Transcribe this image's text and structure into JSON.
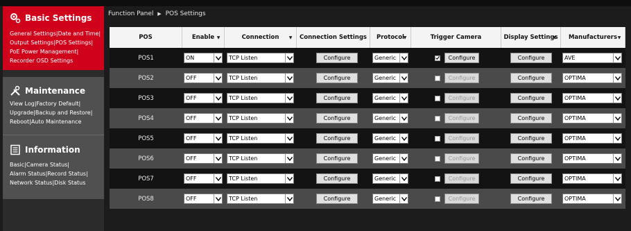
{
  "sidebar": {
    "basic": {
      "title": "Basic Settings",
      "icon": "gears-icon",
      "lines": [
        [
          "General Settings|",
          "Date and Time|"
        ],
        [
          "Output Settings|",
          "POS Settings|"
        ],
        [
          "PoE Power Management|"
        ],
        [
          "Recorder OSD Settings"
        ]
      ]
    },
    "maintenance": {
      "title": "Maintenance",
      "icon": "tools-icon",
      "lines": [
        [
          "View Log|",
          "Factory Default|"
        ],
        [
          "Upgrade|",
          "Backup and Restore|"
        ],
        [
          "Reboot|",
          "Auto Maintenance"
        ]
      ]
    },
    "information": {
      "title": "Information",
      "icon": "document-icon",
      "lines": [
        [
          "Basic|",
          "Camera Status|"
        ],
        [
          "Alarm Status|",
          "Record Status|"
        ],
        [
          "Network Status|",
          "Disk Status"
        ]
      ]
    }
  },
  "breadcrumb": {
    "root": "Function Panel",
    "sep": "▶",
    "current": "POS Settings"
  },
  "table": {
    "headers": [
      "POS",
      "Enable",
      "Connection",
      "Connection Settings",
      "Protocol",
      "Trigger Camera",
      "Display Settings",
      "Manufacturers"
    ],
    "configure_label": "Configure",
    "rows": [
      {
        "pos": "POS1",
        "enable": "ON",
        "connection": "TCP Listen",
        "protocol": "Generic",
        "trigger_checked": true,
        "manufacturer": "AVE"
      },
      {
        "pos": "POS2",
        "enable": "OFF",
        "connection": "TCP Listen",
        "protocol": "Generic",
        "trigger_checked": false,
        "manufacturer": "OPTIMA"
      },
      {
        "pos": "POS3",
        "enable": "OFF",
        "connection": "TCP Listen",
        "protocol": "Generic",
        "trigger_checked": false,
        "manufacturer": "OPTIMA"
      },
      {
        "pos": "POS4",
        "enable": "OFF",
        "connection": "TCP Listen",
        "protocol": "Generic",
        "trigger_checked": false,
        "manufacturer": "OPTIMA"
      },
      {
        "pos": "POS5",
        "enable": "OFF",
        "connection": "TCP Listen",
        "protocol": "Generic",
        "trigger_checked": false,
        "manufacturer": "OPTIMA"
      },
      {
        "pos": "POS6",
        "enable": "OFF",
        "connection": "TCP Listen",
        "protocol": "Generic",
        "trigger_checked": false,
        "manufacturer": "OPTIMA"
      },
      {
        "pos": "POS7",
        "enable": "OFF",
        "connection": "TCP Listen",
        "protocol": "Generic",
        "trigger_checked": false,
        "manufacturer": "OPTIMA"
      },
      {
        "pos": "POS8",
        "enable": "OFF",
        "connection": "TCP Listen",
        "protocol": "Generic",
        "trigger_checked": false,
        "manufacturer": "OPTIMA"
      }
    ]
  },
  "colors": {
    "accent": "#d0021b",
    "row_dark": "#131313",
    "row_light": "#4a4a4a",
    "header_bg": "#f4f4f4"
  }
}
